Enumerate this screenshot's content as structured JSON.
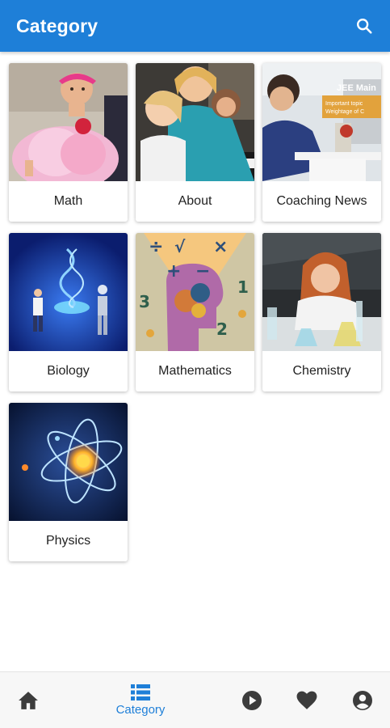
{
  "appbar": {
    "title": "Category",
    "search_icon": "search-icon"
  },
  "categories": [
    {
      "label": "Math",
      "image": "baby-in-pink-dress"
    },
    {
      "label": "About",
      "image": "teacher-with-kids-at-piano"
    },
    {
      "label": "Coaching News",
      "image": "student-studying-jee-main-banner",
      "overlay_text": [
        "JEE Main",
        "Important topic",
        "Weightage of C"
      ]
    },
    {
      "label": "Biology",
      "image": "dna-hologram-with-scientist-and-robot"
    },
    {
      "label": "Mathematics",
      "image": "head-silhouette-with-math-symbols"
    },
    {
      "label": "Chemistry",
      "image": "girl-with-lab-glassware"
    },
    {
      "label": "Physics",
      "image": "glowing-atom"
    }
  ],
  "bottom_nav": {
    "items": [
      {
        "icon": "home-icon",
        "label": ""
      },
      {
        "icon": "list-icon",
        "label": "Category",
        "active": true
      },
      {
        "icon": "play-circle-icon",
        "label": ""
      },
      {
        "icon": "heart-icon",
        "label": ""
      },
      {
        "icon": "account-icon",
        "label": ""
      }
    ]
  },
  "colors": {
    "primary": "#1e7fd8",
    "inactive_icon": "#3c3c3c"
  }
}
